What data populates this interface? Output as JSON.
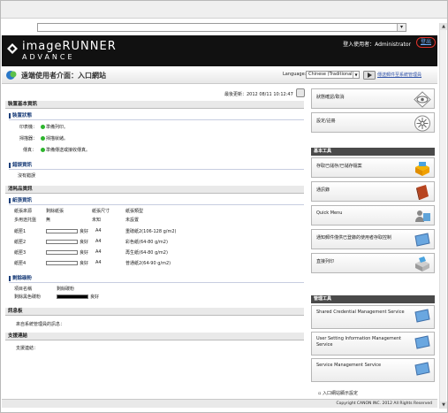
{
  "header": {
    "brand_line1": "imageRUNNER",
    "brand_line2": "ADVANCE",
    "login_label": "登入使用者：",
    "login_user": "Administrator",
    "logout": "登出"
  },
  "titlebar": {
    "title": "遠端使用者介面：入口網站",
    "language_label": "Language:",
    "language_value": "Chinese (Traditional)",
    "link": "傳送郵件至系統管理員"
  },
  "main": {
    "last_update": "最後更新：2012 08/11 10:12:47",
    "device_basic": {
      "header": "裝置基本資訊",
      "status_title": "裝置狀態",
      "rows": [
        {
          "label": "印表機：",
          "status": "準備列印。"
        },
        {
          "label": "掃描器：",
          "status": "掃描就緒。"
        },
        {
          "label": "傳真：",
          "status": "準備傳送或接收傳真。"
        }
      ],
      "error_title": "錯誤資訊",
      "error_text": "沒有錯誤"
    },
    "consumables": {
      "header": "消耗品資訊",
      "paper_title": "紙張資訊",
      "columns": [
        "紙張來源",
        "剩餘紙張",
        "紙張尺寸",
        "紙張類型"
      ],
      "rows": [
        {
          "source": "多用途托盤",
          "remain": "無",
          "size": "未知",
          "type": "未設置"
        },
        {
          "source": "紙匣1",
          "remain": "良好",
          "size": "A4",
          "type": "重磅紙2(106-128 g/m2)"
        },
        {
          "source": "紙匣2",
          "remain": "良好",
          "size": "A4",
          "type": "彩色紙(64-80 g/m2)"
        },
        {
          "source": "紙匣3",
          "remain": "良好",
          "size": "A4",
          "type": "再生紙(64-80 g/m2)"
        },
        {
          "source": "紙匣4",
          "remain": "良好",
          "size": "A4",
          "type": "普通紙2(64-90 g/m2)"
        }
      ],
      "toner_title": "剩餘碳粉",
      "toner_columns": [
        "項目名稱",
        "剩餘碳粉"
      ],
      "toner_rows": [
        {
          "name": "剩餘黑色碳粉",
          "level": "良好"
        }
      ]
    },
    "message_board": {
      "header": "訊息板",
      "text": "來自系統管理員的訊息："
    },
    "support": {
      "header": "支援連結",
      "text": "支援連結："
    }
  },
  "side": {
    "top_buttons": [
      "狀態確認/取消",
      "設定/註冊"
    ],
    "basic_tools_header": "基本工具",
    "basic_tools": [
      "存取已儲存/已儲存檔案",
      "通訊錄",
      "Quick Menu",
      "通知郵件僅供已登錄的使用者存取控制",
      "直接列印"
    ],
    "management_header": "管理工具",
    "management_tools": [
      "Shared Credential Management Service",
      "User Setting Information Management Service",
      "Service Management Service"
    ],
    "portal_settings": "入口網站顯示設定"
  },
  "footer": {
    "copyright": "Copyright CANON INC. 2012 All Rights Reserved"
  }
}
